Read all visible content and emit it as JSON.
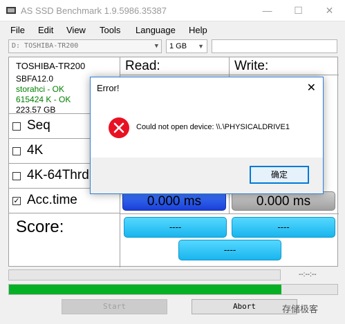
{
  "window": {
    "title": "AS SSD Benchmark 1.9.5986.35387",
    "minimize": "—",
    "maximize": "☐",
    "close": "✕"
  },
  "menu": [
    "File",
    "Edit",
    "View",
    "Tools",
    "Language",
    "Help"
  ],
  "toolbar": {
    "drive": "D: TOSHIBA-TR200",
    "size": "1 GB",
    "text_value": ""
  },
  "drive_info": {
    "name": "TOSHIBA-TR200",
    "firmware": "SBFA12.0",
    "driver": "storahci - OK",
    "alignment": "615424 K - OK",
    "capacity": "223.57 GB"
  },
  "headers": {
    "read": "Read:",
    "write": "Write:"
  },
  "tests": [
    {
      "label": "Seq",
      "checked": false
    },
    {
      "label": "4K",
      "checked": false
    },
    {
      "label": "4K-64Thrd",
      "checked": false
    },
    {
      "label": "Acc.time",
      "checked": true
    }
  ],
  "results": {
    "acc_read": "0.000 ms",
    "acc_write": "0.000 ms"
  },
  "score": {
    "label": "Score:",
    "read": "----",
    "write": "----",
    "total": "----"
  },
  "progress": {
    "time_text": "--:--:--",
    "overall": 0.83
  },
  "buttons": {
    "start": "Start",
    "abort": "Abort"
  },
  "dialog": {
    "title": "Error!",
    "close": "✕",
    "message": "Could not open device: \\\\.\\PHYSICALDRIVE1",
    "ok": "确定"
  },
  "watermark": "存储极客",
  "colors": {
    "accent": "#19b5ee",
    "progress": "#06b025",
    "error": "#e81123",
    "ok_text": "#008000"
  }
}
